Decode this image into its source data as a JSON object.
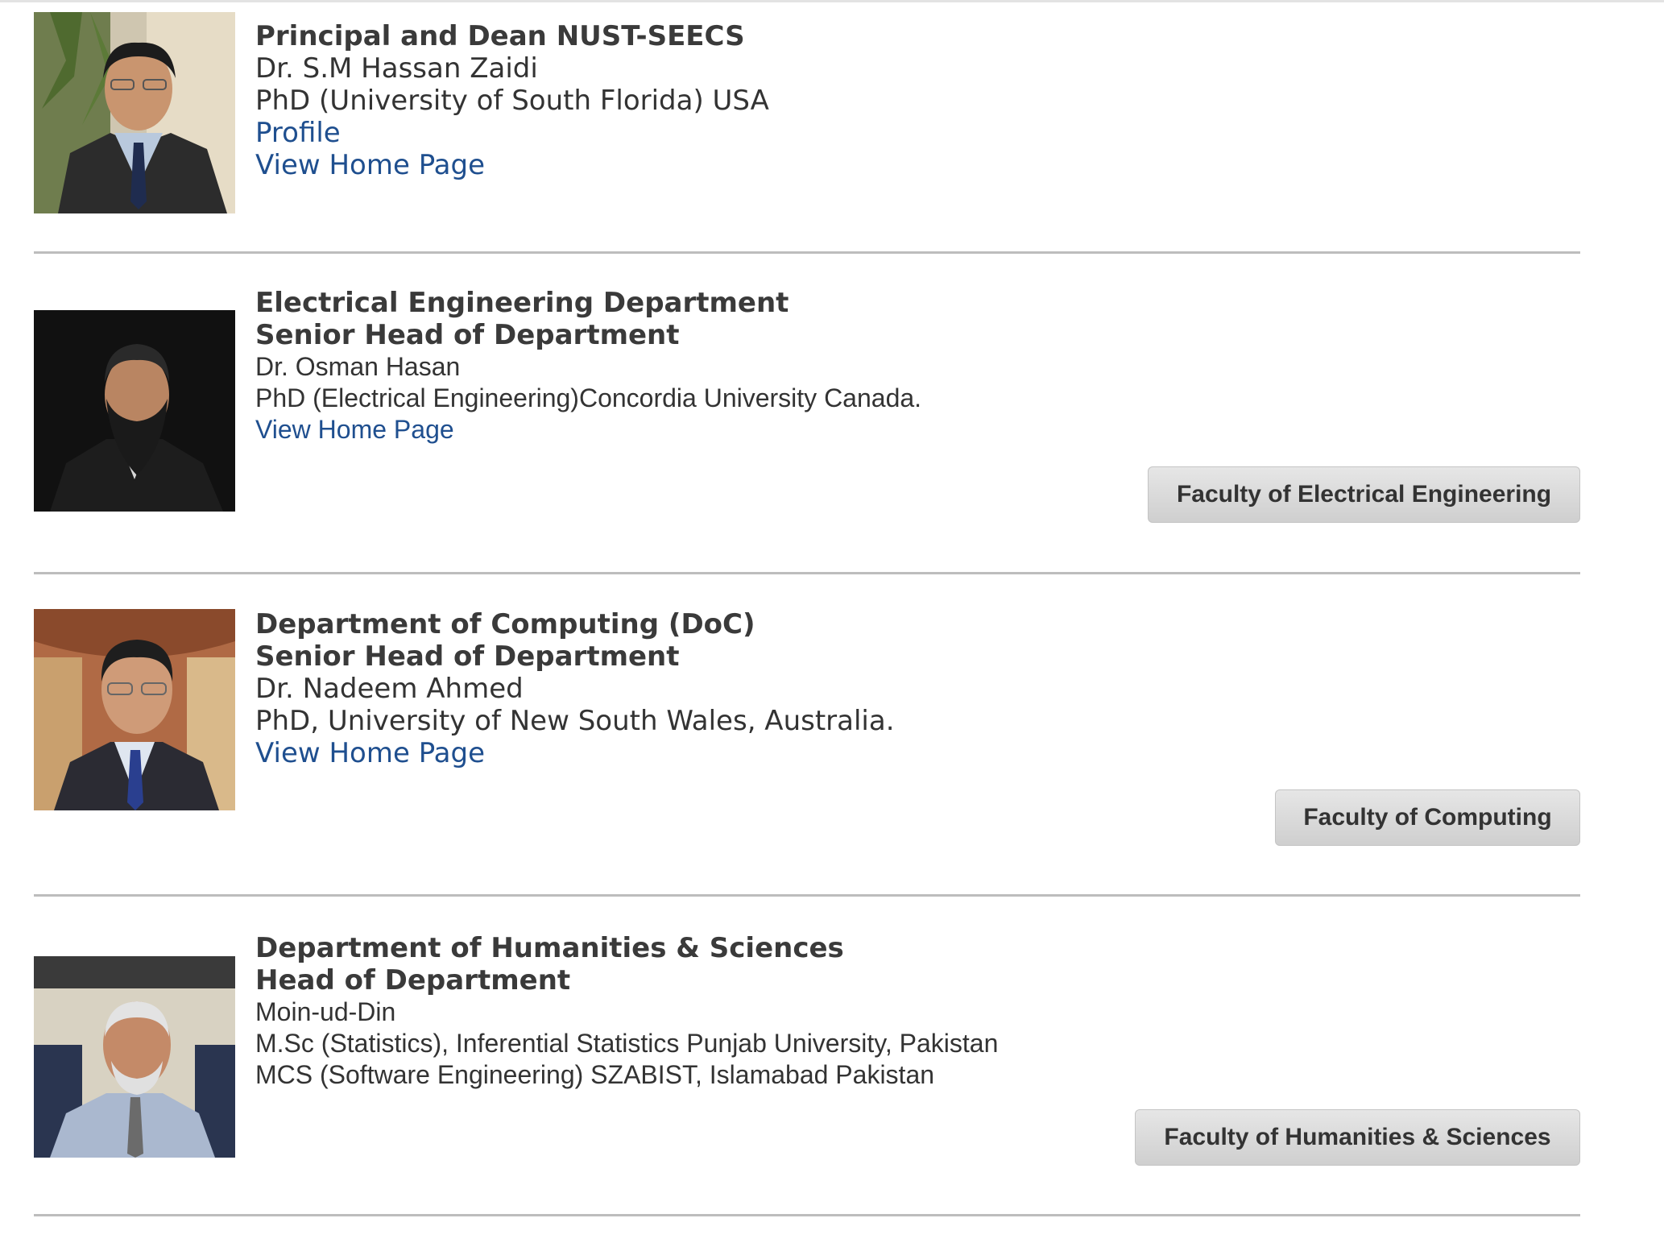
{
  "entries": [
    {
      "heading1": "Principal and Dean NUST-SEECS",
      "name": "Dr. S.M Hassan Zaidi",
      "degree": "PhD (University of South Florida) USA",
      "profile_link": "Profile",
      "home_link": "View Home Page"
    },
    {
      "heading1": "Electrical Engineering Department",
      "heading2": "Senior Head of Department",
      "name": "Dr. Osman Hasan",
      "degree": "PhD (Electrical Engineering)Concordia University Canada.",
      "home_link": "View Home Page",
      "faculty_button": "Faculty of Electrical Engineering"
    },
    {
      "heading1": "Department of Computing (DoC)",
      "heading2": "Senior Head of Department",
      "name": "Dr. Nadeem Ahmed",
      "degree": "PhD, University of New South Wales, Australia.",
      "home_link": "View Home Page",
      "faculty_button": "Faculty of Computing"
    },
    {
      "heading1": "Department of Humanities & Sciences",
      "heading2": "Head of Department",
      "name": "Moin-ud-Din",
      "degree": "M.Sc (Statistics), Inferential Statistics Punjab University, Pakistan",
      "degree2": "MCS (Software Engineering) SZABIST, Islamabad Pakistan",
      "faculty_button": "Faculty of Humanities & Sciences"
    }
  ],
  "colors": {
    "link": "#1f4f8f",
    "heading": "#3a3a3a",
    "button_bg": "#d9d9d9",
    "rule": "#bdbdbd"
  }
}
